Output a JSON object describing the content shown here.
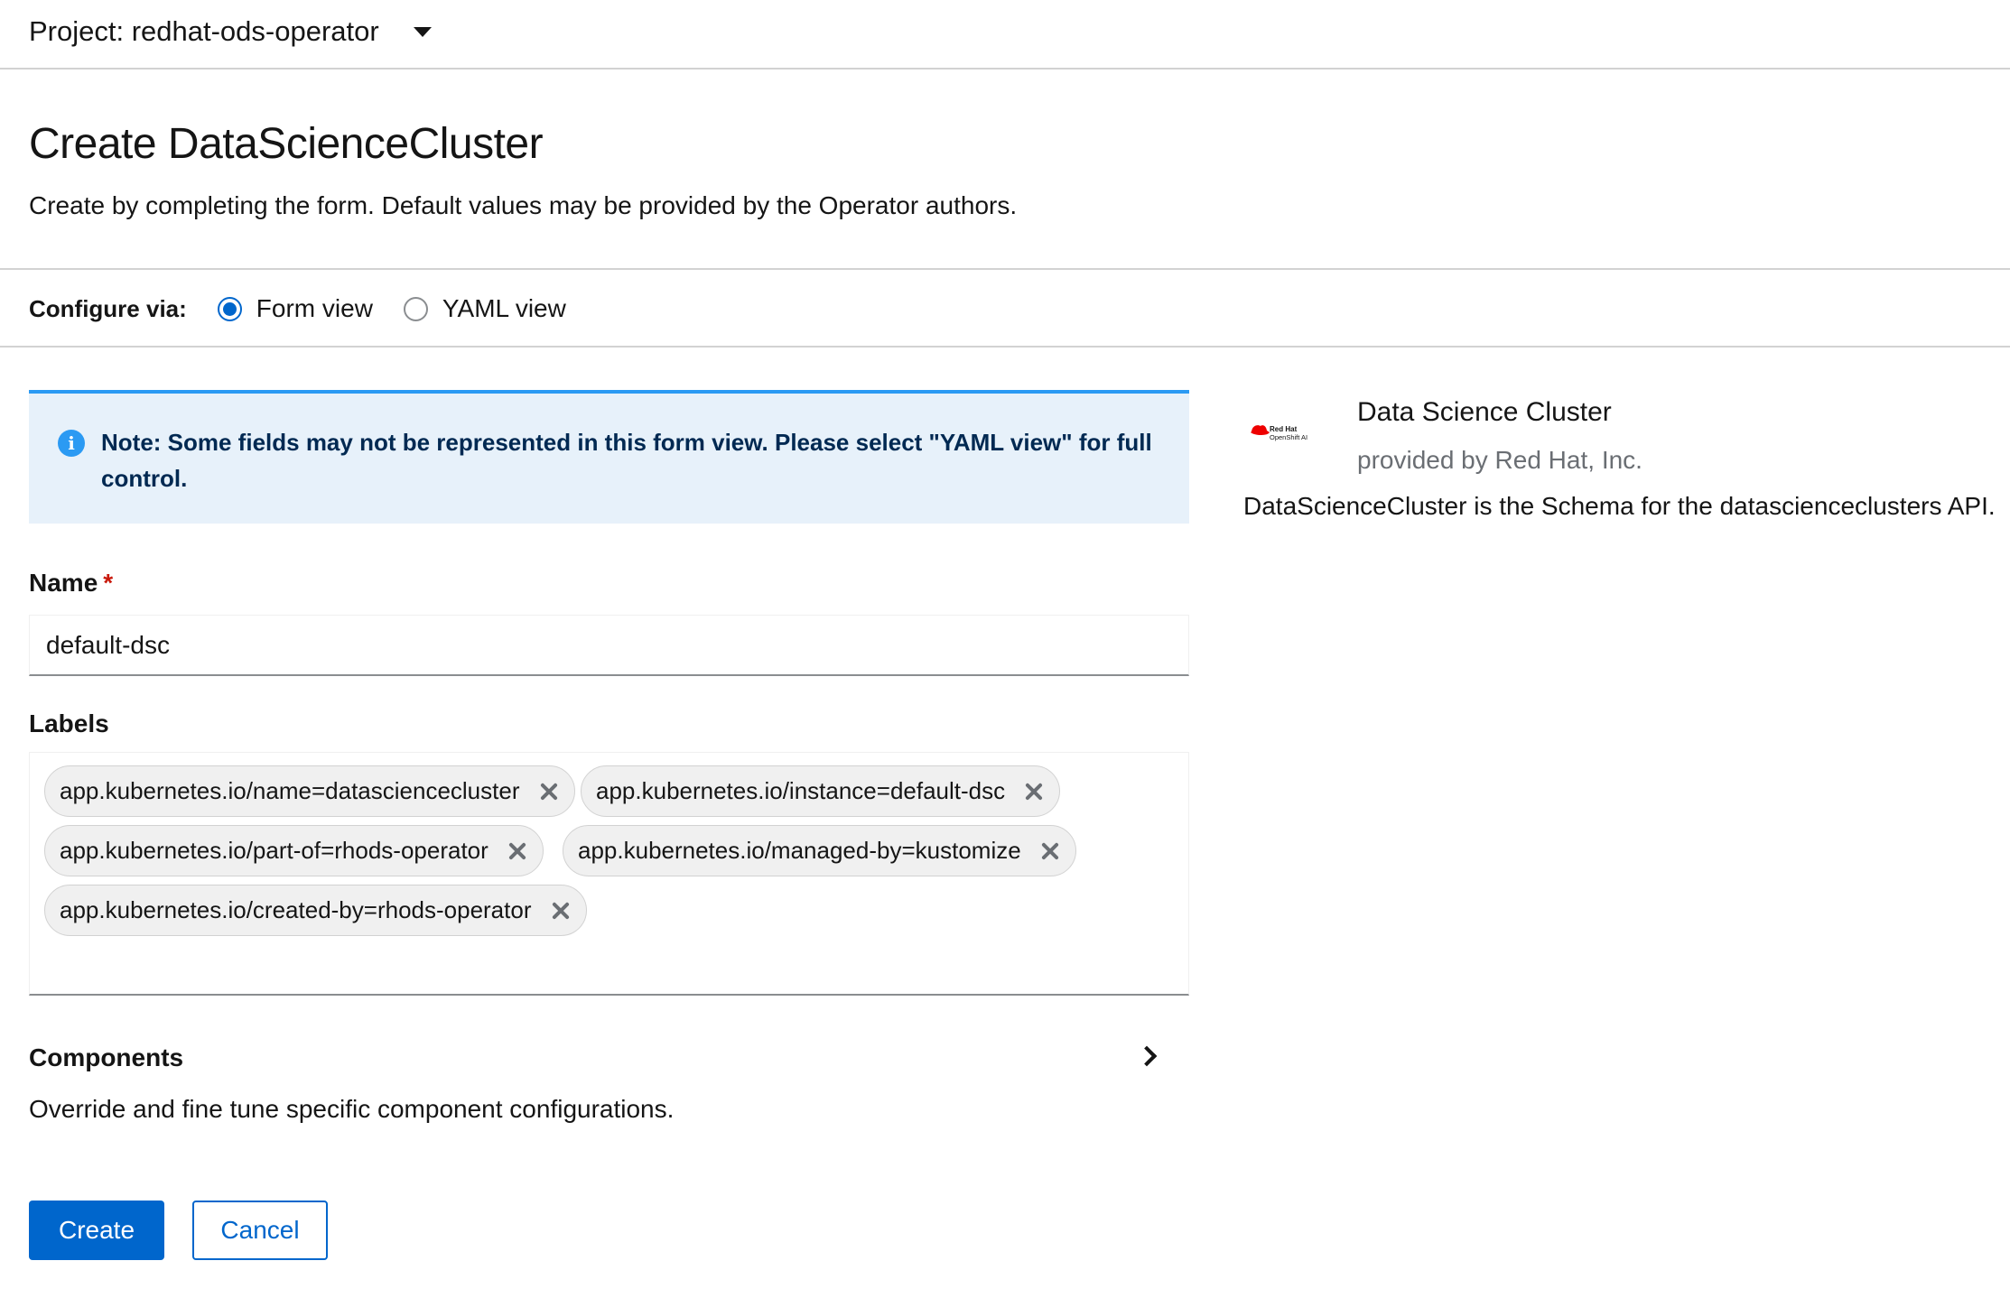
{
  "project": {
    "label": "Project: redhat-ods-operator"
  },
  "page": {
    "title": "Create DataScienceCluster",
    "description": "Create by completing the form. Default values may be provided by the Operator authors."
  },
  "configure": {
    "label": "Configure via:",
    "options": [
      {
        "label": "Form view",
        "selected": true
      },
      {
        "label": "YAML view",
        "selected": false
      }
    ]
  },
  "alert": {
    "icon": "info-icon",
    "icon_glyph": "i",
    "text": "Note: Some fields may not be represented in this form view. Please select \"YAML view\" for full control."
  },
  "form": {
    "name_label": "Name",
    "required_mark": "*",
    "name_value": "default-dsc",
    "labels_label": "Labels",
    "labels": [
      "app.kubernetes.io/name=datasciencecluster",
      "app.kubernetes.io/instance=default-dsc",
      "app.kubernetes.io/part-of=rhods-operator",
      "app.kubernetes.io/managed-by=kustomize",
      "app.kubernetes.io/created-by=rhods-operator"
    ],
    "components_title": "Components",
    "components_desc": "Override and fine tune specific component configurations."
  },
  "actions": {
    "create": "Create",
    "cancel": "Cancel"
  },
  "side": {
    "logo_brand": "Red Hat",
    "logo_product": "OpenShift AI",
    "title": "Data Science Cluster",
    "provider": "provided by Red Hat, Inc.",
    "description": "DataScienceCluster is the Schema for the datascienceclusters API."
  },
  "colors": {
    "primary": "#0066cc",
    "alert_bg": "#e7f1fa",
    "alert_border": "#2b9af3",
    "required": "#c9190b",
    "logo_red": "#ee0000"
  }
}
